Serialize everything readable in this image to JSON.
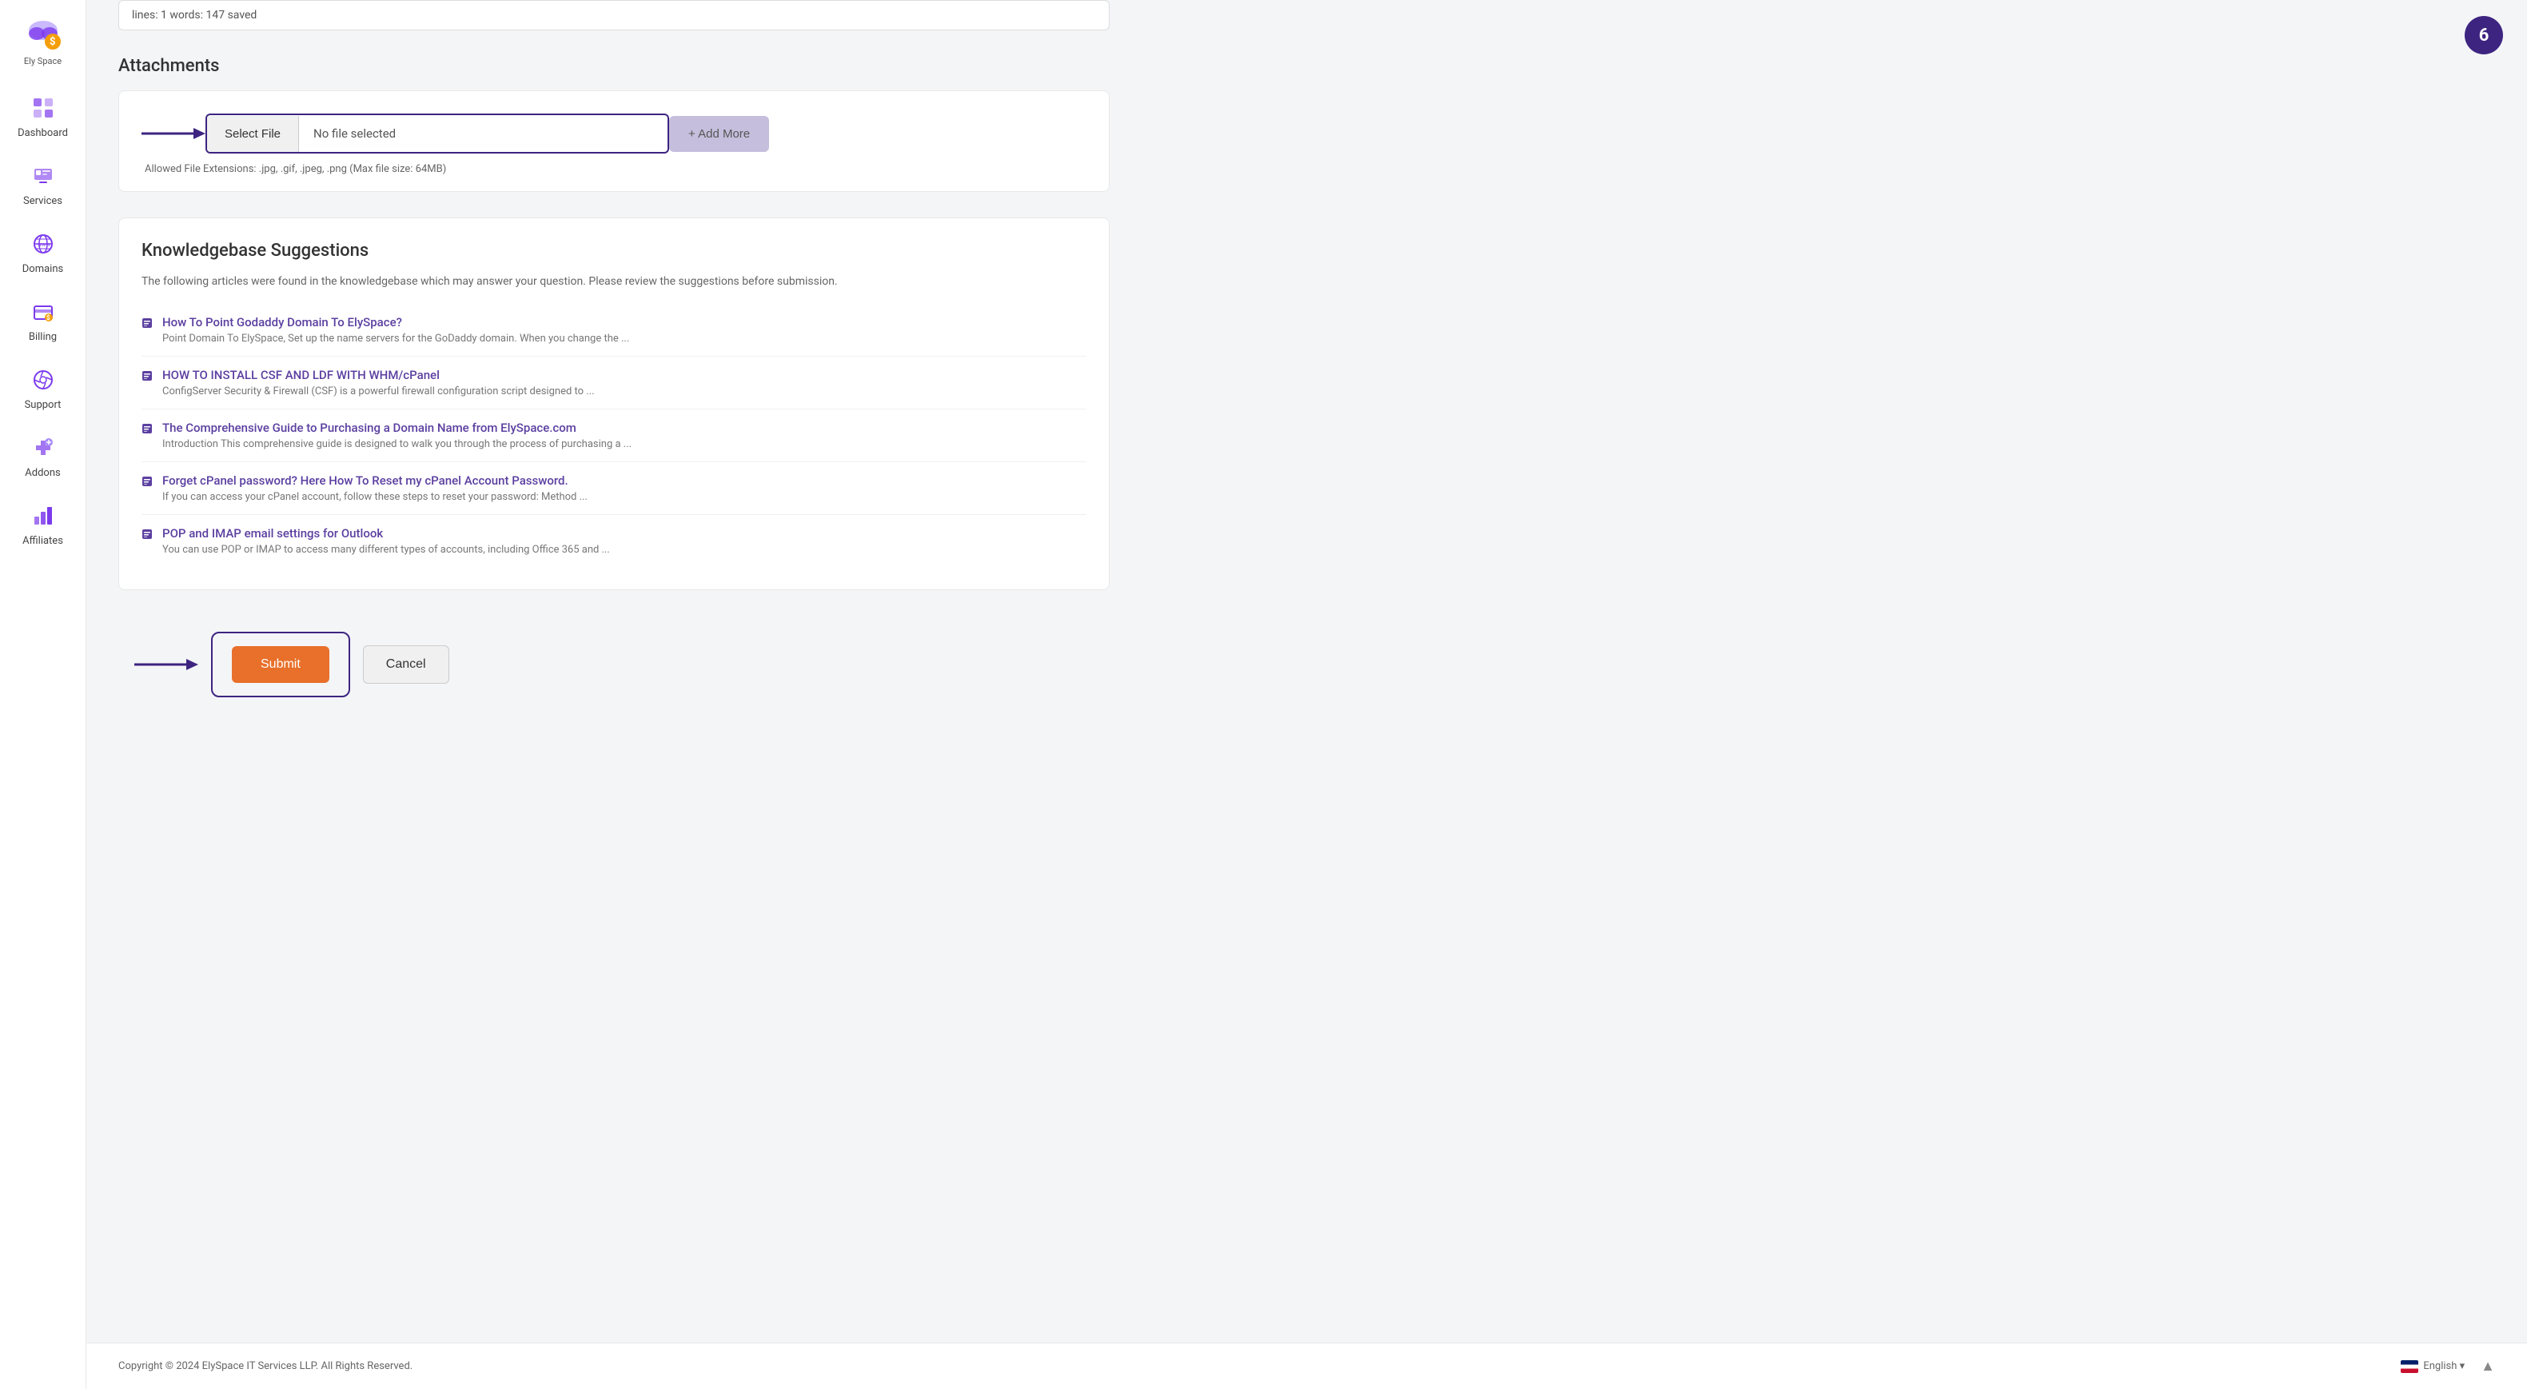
{
  "app": {
    "name": "Ely Space",
    "logo_alt": "ElySpace logo"
  },
  "sidebar": {
    "items": [
      {
        "id": "dashboard",
        "label": "Dashboard",
        "icon": "dashboard-icon"
      },
      {
        "id": "services",
        "label": "Services",
        "icon": "services-icon"
      },
      {
        "id": "domains",
        "label": "Domains",
        "icon": "domains-icon"
      },
      {
        "id": "billing",
        "label": "Billing",
        "icon": "billing-icon"
      },
      {
        "id": "support",
        "label": "Support",
        "icon": "support-icon"
      },
      {
        "id": "addons",
        "label": "Addons",
        "icon": "addons-icon"
      },
      {
        "id": "affiliates",
        "label": "Affiliates",
        "icon": "affiliates-icon"
      }
    ]
  },
  "notification_badge": "6",
  "text_info_bar": "lines: 1  words: 147  saved",
  "attachments": {
    "title": "Attachments",
    "select_file_label": "Select File",
    "no_file_text": "No file selected",
    "allowed_extensions": "Allowed File Extensions: .jpg, .gif, .jpeg, .png (Max file size: 64MB)",
    "add_more_label": "+ Add More"
  },
  "knowledgebase": {
    "title": "Knowledgebase Suggestions",
    "description": "The following articles were found in the knowledgebase which may answer your question. Please review the suggestions before submission.",
    "items": [
      {
        "title": "How To Point Godaddy Domain To ElySpace?",
        "description": "Point Domain To ElySpace, Set up the name servers for the GoDaddy domain. When you change the ..."
      },
      {
        "title": "HOW TO INSTALL CSF AND LDF WITH WHM/cPanel",
        "description": "ConfigServer Security & Firewall (CSF) is a powerful firewall configuration script designed to ..."
      },
      {
        "title": "The Comprehensive Guide to Purchasing a Domain Name from ElySpace.com",
        "description": "Introduction This comprehensive guide is designed to walk you through the process of purchasing a ..."
      },
      {
        "title": "Forget cPanel password? Here How To Reset my cPanel Account Password.",
        "description": "If you can access your cPanel account, follow these steps to reset your password: Method ..."
      },
      {
        "title": "POP and IMAP email settings for Outlook",
        "description": "You can use POP or IMAP to access many different types of accounts, including Office 365 and ..."
      }
    ]
  },
  "actions": {
    "submit_label": "Submit",
    "cancel_label": "Cancel"
  },
  "footer": {
    "copyright": "Copyright © 2024 ElySpace IT Services LLP. All Rights Reserved.",
    "language": "English ▾"
  }
}
